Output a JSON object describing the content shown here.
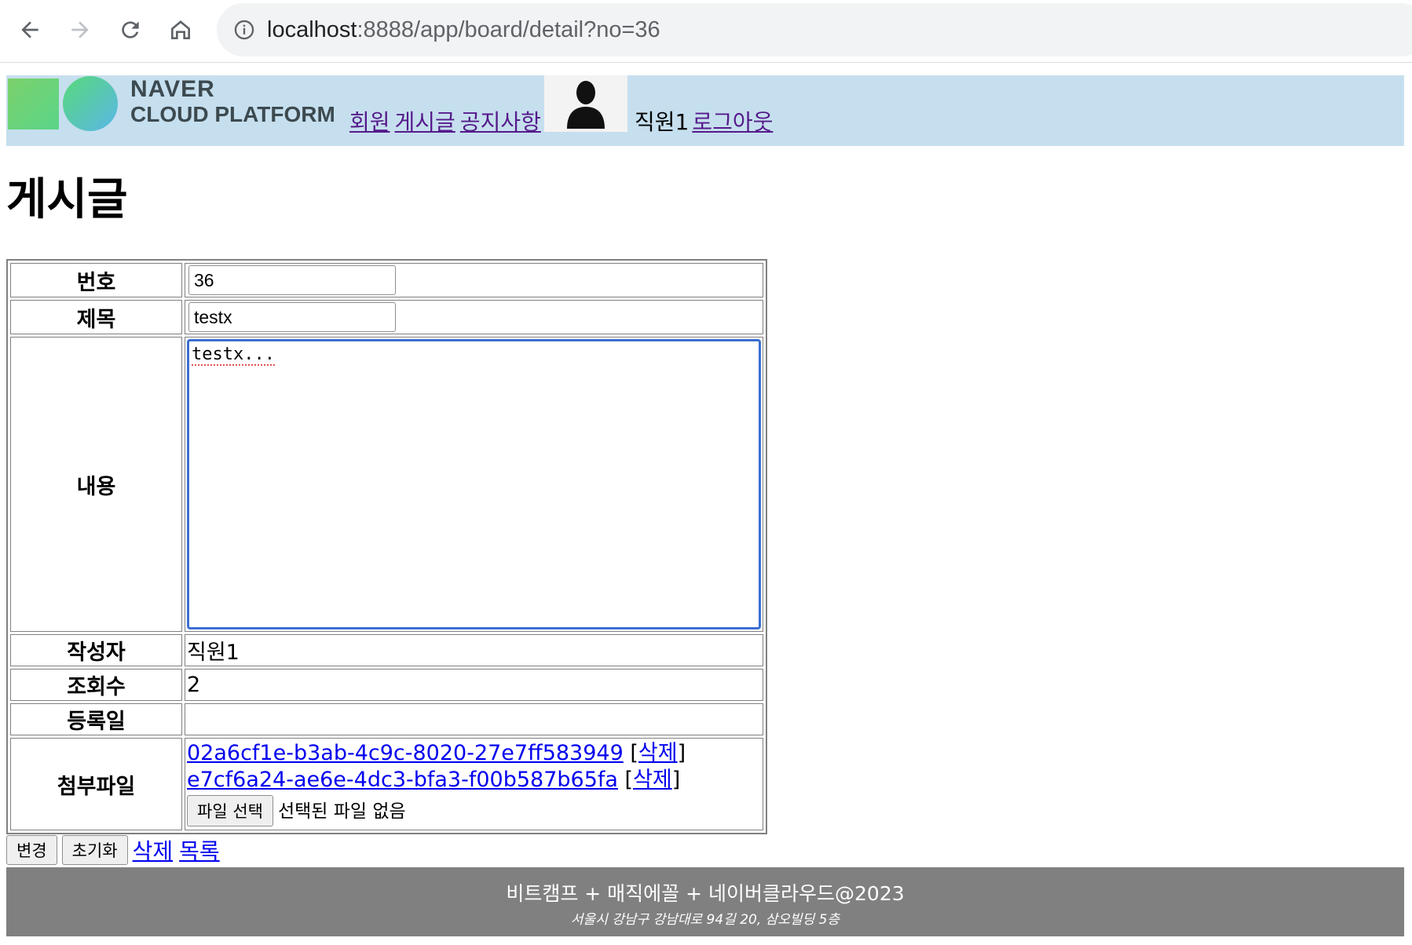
{
  "browser": {
    "url_host": "localhost",
    "url_path": ":8888/app/board/detail?no=36"
  },
  "header": {
    "logo_line1": "NAVER",
    "logo_line2": "CLOUD PLATFORM",
    "menu": [
      "회원",
      "게시글",
      "공지사항"
    ],
    "user_name": "직원1",
    "logout_label": "로그아웃"
  },
  "page_title": "게시글",
  "form": {
    "no_label": "번호",
    "no_value": "36",
    "title_label": "제목",
    "title_value": "testx",
    "content_label": "내용",
    "content_value": "testx...",
    "writer_label": "작성자",
    "writer_value": "직원1",
    "views_label": "조회수",
    "views_value": "2",
    "created_label": "등록일",
    "created_value": "",
    "files_label": "첨부파일",
    "files": [
      {
        "name": "02a6cf1e-b3ab-4c9c-8020-27e7ff583949",
        "delete_label": "삭제"
      },
      {
        "name": "e7cf6a24-ae6e-4dc3-bfa3-f00b587b65fa",
        "delete_label": "삭제"
      }
    ],
    "file_button_label": "파일 선택",
    "file_none_label": "선택된 파일 없음"
  },
  "actions": {
    "update_label": "변경",
    "reset_label": "초기화",
    "delete_label": "삭제",
    "list_label": "목록"
  },
  "footer": {
    "line1": "비트캠프 + 매직에꼴 + 네이버클라우드@2023",
    "line2": "서울시 강남구 강남대로 94길 20, 삼오빌딩 5층"
  },
  "icons": [
    "back-arrow-icon",
    "forward-arrow-icon",
    "reload-icon",
    "home-icon",
    "info-icon",
    "user-avatar-icon"
  ]
}
